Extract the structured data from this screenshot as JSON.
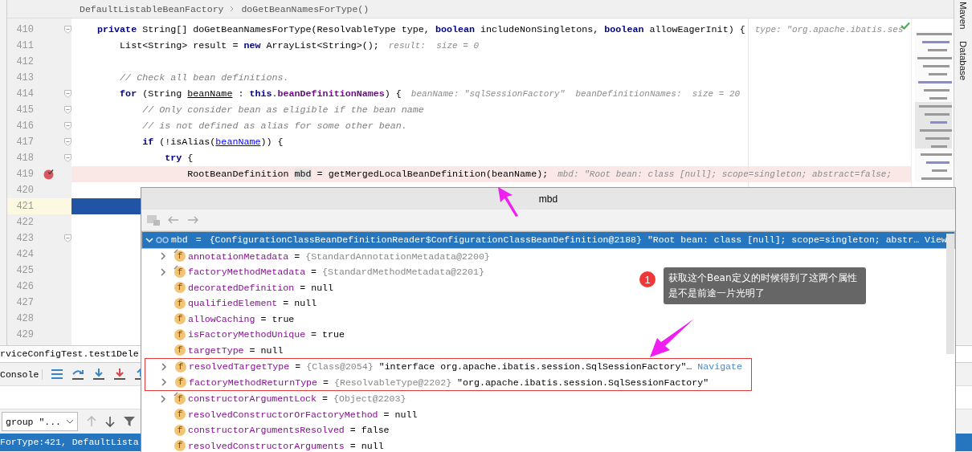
{
  "breadcrumb": [
    "DefaultListableBeanFactory",
    "doGetBeanNamesForType()"
  ],
  "editor": {
    "lines": [
      {
        "number": "410",
        "fold": true,
        "segments": [
          {
            "kind": "kw",
            "text": "    private "
          },
          {
            "kind": "plain",
            "text": "String[] doGetBeanNamesForType(ResolvableType type, "
          },
          {
            "kind": "kw",
            "text": "boolean"
          },
          {
            "kind": "plain",
            "text": " includeNonSingletons, "
          },
          {
            "kind": "kw",
            "text": "boolean"
          },
          {
            "kind": "plain",
            "text": " allowEagerInit) {"
          }
        ],
        "hint": "type: \"org.apache.ibatis.ses"
      },
      {
        "number": "411",
        "segments": [
          {
            "kind": "plain",
            "text": "        List<String> result = "
          },
          {
            "kind": "kw",
            "text": "new"
          },
          {
            "kind": "plain",
            "text": " ArrayList<String>();"
          }
        ],
        "hint": "result:  size = 0"
      },
      {
        "number": "412"
      },
      {
        "number": "413",
        "segments": [
          {
            "kind": "comment",
            "text": "        // Check all bean definitions."
          }
        ]
      },
      {
        "number": "414",
        "fold": true,
        "segments": [
          {
            "kind": "kw",
            "text": "        for"
          },
          {
            "kind": "plain",
            "text": " (String "
          },
          {
            "kind": "var",
            "text": "beanName"
          },
          {
            "kind": "plain",
            "text": " : "
          },
          {
            "kind": "kw",
            "text": "this"
          },
          {
            "kind": "plain",
            "text": "."
          },
          {
            "kind": "field",
            "text": "beanDefinitionNames"
          },
          {
            "kind": "plain",
            "text": ") {"
          }
        ],
        "hint": "beanName: \"sqlSessionFactory\"  beanDefinitionNames:  size = 20"
      },
      {
        "number": "415",
        "fold": true,
        "segments": [
          {
            "kind": "comment",
            "text": "            // Only consider bean as eligible if the bean name"
          }
        ]
      },
      {
        "number": "416",
        "fold": true,
        "segments": [
          {
            "kind": "comment",
            "text": "            // is not defined as alias for some other bean."
          }
        ]
      },
      {
        "number": "417",
        "fold": true,
        "segments": [
          {
            "kind": "kw",
            "text": "            if"
          },
          {
            "kind": "plain",
            "text": " (!isAlias("
          },
          {
            "kind": "link",
            "text": "beanName"
          },
          {
            "kind": "plain",
            "text": ")) {"
          }
        ]
      },
      {
        "number": "418",
        "fold": true,
        "segments": [
          {
            "kind": "kw",
            "text": "                try"
          },
          {
            "kind": "plain",
            "text": " {"
          }
        ]
      },
      {
        "number": "419",
        "breakpoint": true,
        "segments": [
          {
            "kind": "plain",
            "text": "                    RootBeanDefinition "
          },
          {
            "kind": "hl",
            "text": "mbd"
          },
          {
            "kind": "plain",
            "text": " = getMergedLocalBeanDefinition(beanName);"
          }
        ],
        "hint": "mbd: \"Root bean: class [null]; scope=singleton; abstract=false;"
      },
      {
        "number": "420"
      },
      {
        "number": "421",
        "current": true
      },
      {
        "number": "422"
      },
      {
        "number": "423",
        "fold": true
      },
      {
        "number": "424"
      },
      {
        "number": "425"
      },
      {
        "number": "426"
      },
      {
        "number": "427"
      },
      {
        "number": "428"
      },
      {
        "number": "429"
      }
    ]
  },
  "right_tools": [
    "Maven",
    "Database"
  ],
  "debug": {
    "session_tab": "rviceConfigTest.test1Dele",
    "console_tab": "Console",
    "thread_select": "group \"...",
    "frame": {
      "text": "ForType:421, DefaultLista",
      "selected": true
    }
  },
  "popup": {
    "title": "mbd",
    "equals": "=",
    "tree": [
      {
        "name": "mbd",
        "ref": "{ConfigurationClassBeanDefinitionReader$ConfigurationClassBeanDefinition@2188}",
        "value": "\"Root bean: class [null]; scope=singleton; abstr…",
        "link": "View",
        "selected": true,
        "expanded": true,
        "children": [
          {
            "icon": "f",
            "final": true,
            "expandable": true,
            "name": "annotationMetadata",
            "ref": "{StandardAnnotationMetadata@2200}"
          },
          {
            "icon": "f",
            "final": true,
            "expandable": true,
            "name": "factoryMethodMetadata",
            "ref": "{StandardMethodMetadata@2201}"
          },
          {
            "icon": "f",
            "name": "decoratedDefinition",
            "value": "null"
          },
          {
            "icon": "f",
            "name": "qualifiedElement",
            "value": "null"
          },
          {
            "icon": "f",
            "name": "allowCaching",
            "value": "true"
          },
          {
            "icon": "f",
            "name": "isFactoryMethodUnique",
            "value": "true"
          },
          {
            "icon": "f",
            "name": "targetType",
            "value": "null"
          },
          {
            "icon": "f",
            "expandable": true,
            "highlighted": true,
            "name": "resolvedTargetType",
            "ref": "{Class@2054}",
            "value": "\"interface org.apache.ibatis.session.SqlSessionFactory\"…",
            "link": "Navigate"
          },
          {
            "icon": "f",
            "expandable": true,
            "highlighted": true,
            "name": "factoryMethodReturnType",
            "ref": "{ResolvableType@2202}",
            "value": "\"org.apache.ibatis.session.SqlSessionFactory\""
          },
          {
            "icon": "f",
            "final": true,
            "expandable": true,
            "name": "constructorArgumentLock",
            "ref": "{Object@2203}"
          },
          {
            "icon": "f",
            "name": "resolvedConstructorOrFactoryMethod",
            "value": "null"
          },
          {
            "icon": "f",
            "name": "constructorArgumentsResolved",
            "value": "false"
          },
          {
            "icon": "f",
            "name": "resolvedConstructorArguments",
            "value": "null"
          }
        ]
      }
    ]
  },
  "annotation": {
    "badge": "1",
    "text": "获取这个Bean定义的时候得到了这两个属性是不是前途一片光明了"
  }
}
